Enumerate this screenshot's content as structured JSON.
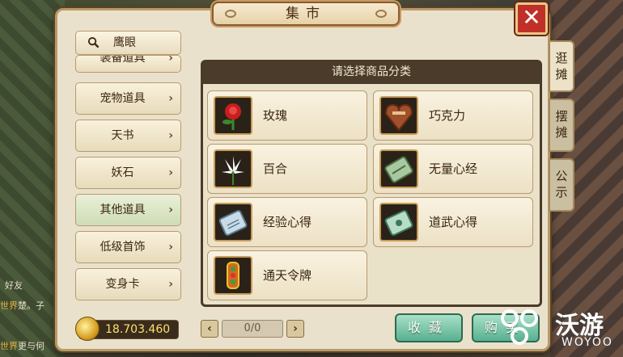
{
  "window": {
    "title": "集市"
  },
  "search": {
    "label": "鹰眼"
  },
  "sidebar": {
    "items": [
      {
        "label": "装备道具",
        "active": false
      },
      {
        "label": "宠物道具",
        "active": false
      },
      {
        "label": "天书",
        "active": false
      },
      {
        "label": "妖石",
        "active": false
      },
      {
        "label": "其他道具",
        "active": true
      },
      {
        "label": "低级首饰",
        "active": false
      },
      {
        "label": "变身卡",
        "active": false
      }
    ]
  },
  "currency": {
    "amount": "18.703.460"
  },
  "main": {
    "header": "请选择商品分类",
    "items": [
      {
        "label": "玫瑰",
        "icon": "rose-icon"
      },
      {
        "label": "巧克力",
        "icon": "chocolate-icon"
      },
      {
        "label": "百合",
        "icon": "lily-icon"
      },
      {
        "label": "无量心经",
        "icon": "jade-scroll-icon"
      },
      {
        "label": "经验心得",
        "icon": "experience-scroll-icon"
      },
      {
        "label": "道武心得",
        "icon": "daowu-scroll-icon"
      },
      {
        "label": "通天令牌",
        "icon": "token-icon"
      }
    ]
  },
  "pagination": {
    "text": "0/0",
    "prev": "‹",
    "next": "›"
  },
  "actions": {
    "favorite": "收藏",
    "buy": "购买"
  },
  "tabs": [
    {
      "label": "逛摊",
      "active": true
    },
    {
      "label": "摆摊",
      "active": false
    },
    {
      "label": "公示",
      "active": false
    }
  ],
  "background": {
    "chat": [
      {
        "channel": "世界",
        "text": "楚。子"
      },
      {
        "channel": "世界",
        "text": "更与何"
      }
    ],
    "friend_label": "好友"
  },
  "watermark": {
    "cn": "沃游",
    "en": "WOYOO"
  },
  "colors": {
    "accent_green": "#58b090",
    "close_red": "#c03028",
    "gold": "#ffe070"
  }
}
